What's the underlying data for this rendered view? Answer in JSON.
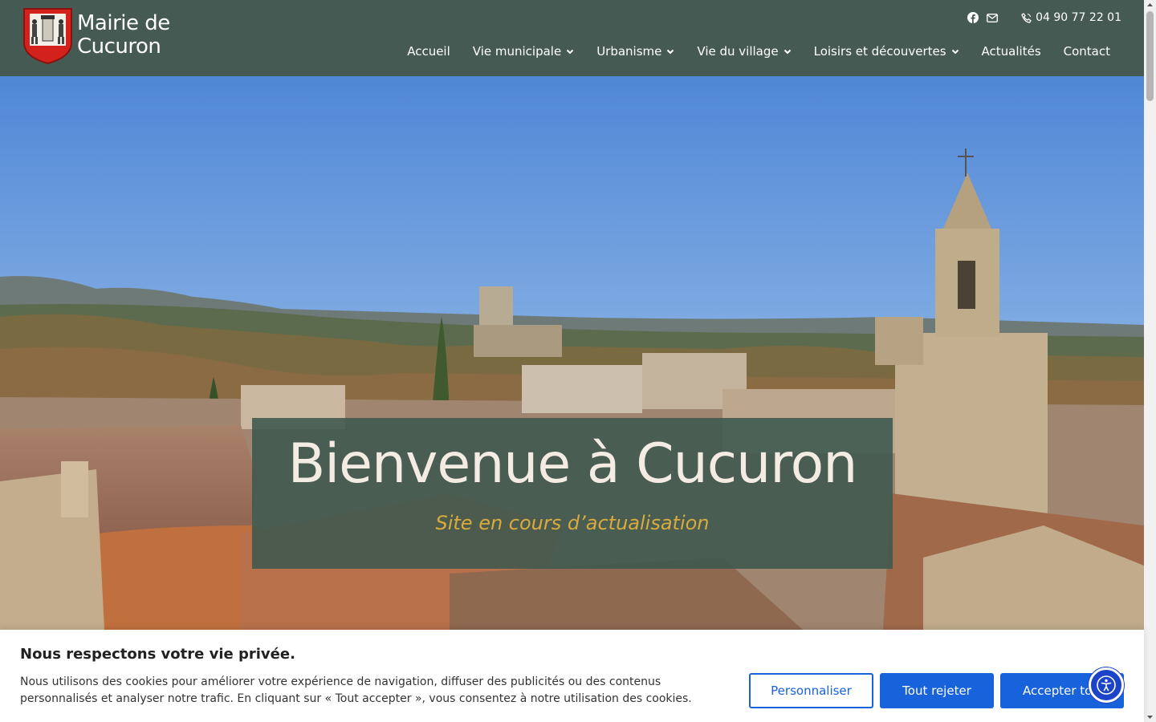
{
  "header": {
    "logo_line1": "Mairie de",
    "logo_line2": "Cucuron",
    "phone": "04 90 77 22 01",
    "icons": [
      "facebook-icon",
      "envelope-icon",
      "phone-icon"
    ],
    "background": "#465a54"
  },
  "nav": {
    "items": [
      {
        "label": "Accueil",
        "dropdown": false
      },
      {
        "label": "Vie municipale",
        "dropdown": true
      },
      {
        "label": "Urbanisme",
        "dropdown": true
      },
      {
        "label": "Vie du village",
        "dropdown": true
      },
      {
        "label": "Loisirs et découvertes",
        "dropdown": true
      },
      {
        "label": "Actualités",
        "dropdown": false
      },
      {
        "label": "Contact",
        "dropdown": false
      }
    ]
  },
  "hero": {
    "title": "Bienvenue à Cucuron",
    "subtitle": "Site en cours d’actualisation",
    "subtitle_color": "#d8ab3e"
  },
  "cookie": {
    "title": "Nous respectons votre vie privée.",
    "text": "Nous utilisons des cookies pour améliorer votre expérience de navigation, diffuser des publicités ou des contenus personnalisés et analyser notre trafic. En cliquant sur « Tout accepter », vous consentez à notre utilisation des cookies.",
    "customize_label": "Personnaliser",
    "reject_label": "Tout rejeter",
    "accept_label": "Accepter tout",
    "accent": "#1863dc"
  }
}
